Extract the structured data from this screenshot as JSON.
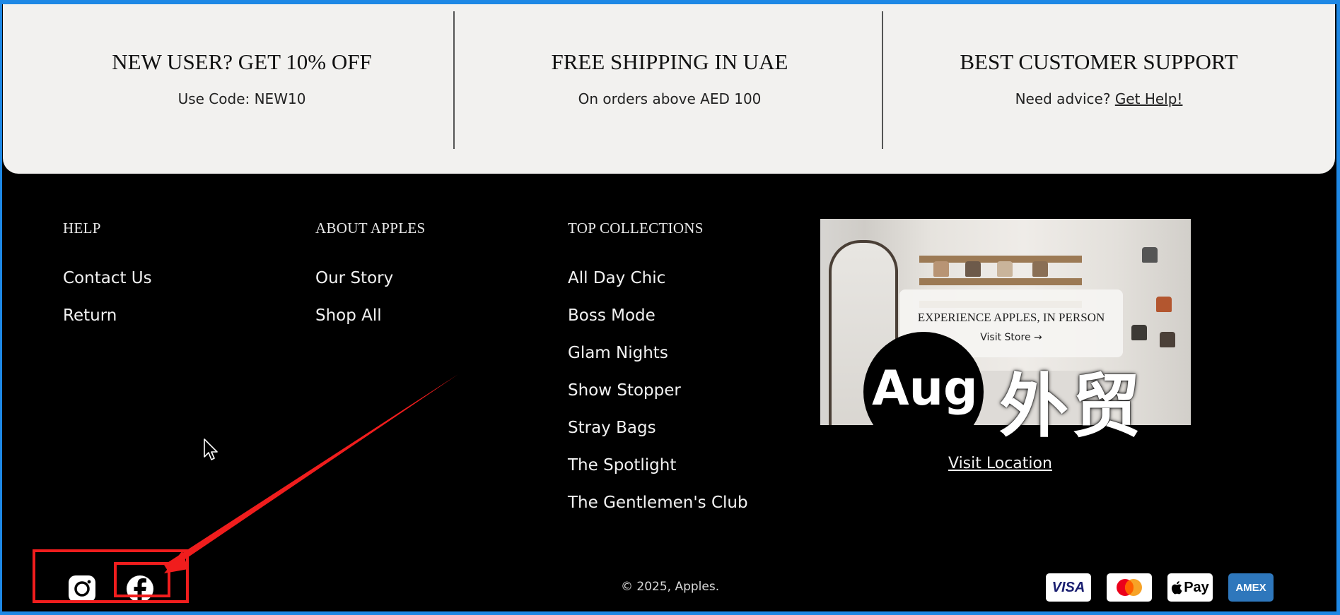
{
  "promo": [
    {
      "title": "NEW USER? GET 10% OFF",
      "subtitle": "Use Code: NEW10"
    },
    {
      "title": "FREE SHIPPING IN UAE",
      "subtitle": "On orders above AED 100"
    },
    {
      "title": "BEST CUSTOMER SUPPORT",
      "subtitle_prefix": "Need advice? ",
      "link_label": "Get Help!"
    }
  ],
  "footer": {
    "help": {
      "heading": "HELP",
      "links": [
        "Contact Us",
        "Return"
      ]
    },
    "about": {
      "heading": "ABOUT APPLES",
      "links": [
        "Our Story",
        "Shop All"
      ]
    },
    "collections": {
      "heading": "TOP COLLECTIONS",
      "links": [
        "All Day Chic",
        "Boss Mode",
        "Glam Nights",
        "Show Stopper",
        "Stray Bags",
        "The Spotlight",
        "The Gentlemen's Club"
      ]
    },
    "store": {
      "card_title": "EXPERIENCE APPLES, IN PERSON",
      "card_link": "Visit Store →",
      "visit_location": "Visit Location"
    },
    "copyright": "© 2025, Apples.",
    "social": [
      "instagram-icon",
      "facebook-icon"
    ],
    "payments": [
      "VISA",
      "mastercard",
      "Pay",
      "AMEX"
    ]
  },
  "watermark": {
    "badge": "Aug",
    "text": "外贸"
  },
  "colors": {
    "page_bg": "#000000",
    "promo_bg": "#f2f1ef",
    "annotation": "#f01d1d",
    "frame": "#1e88e5"
  }
}
